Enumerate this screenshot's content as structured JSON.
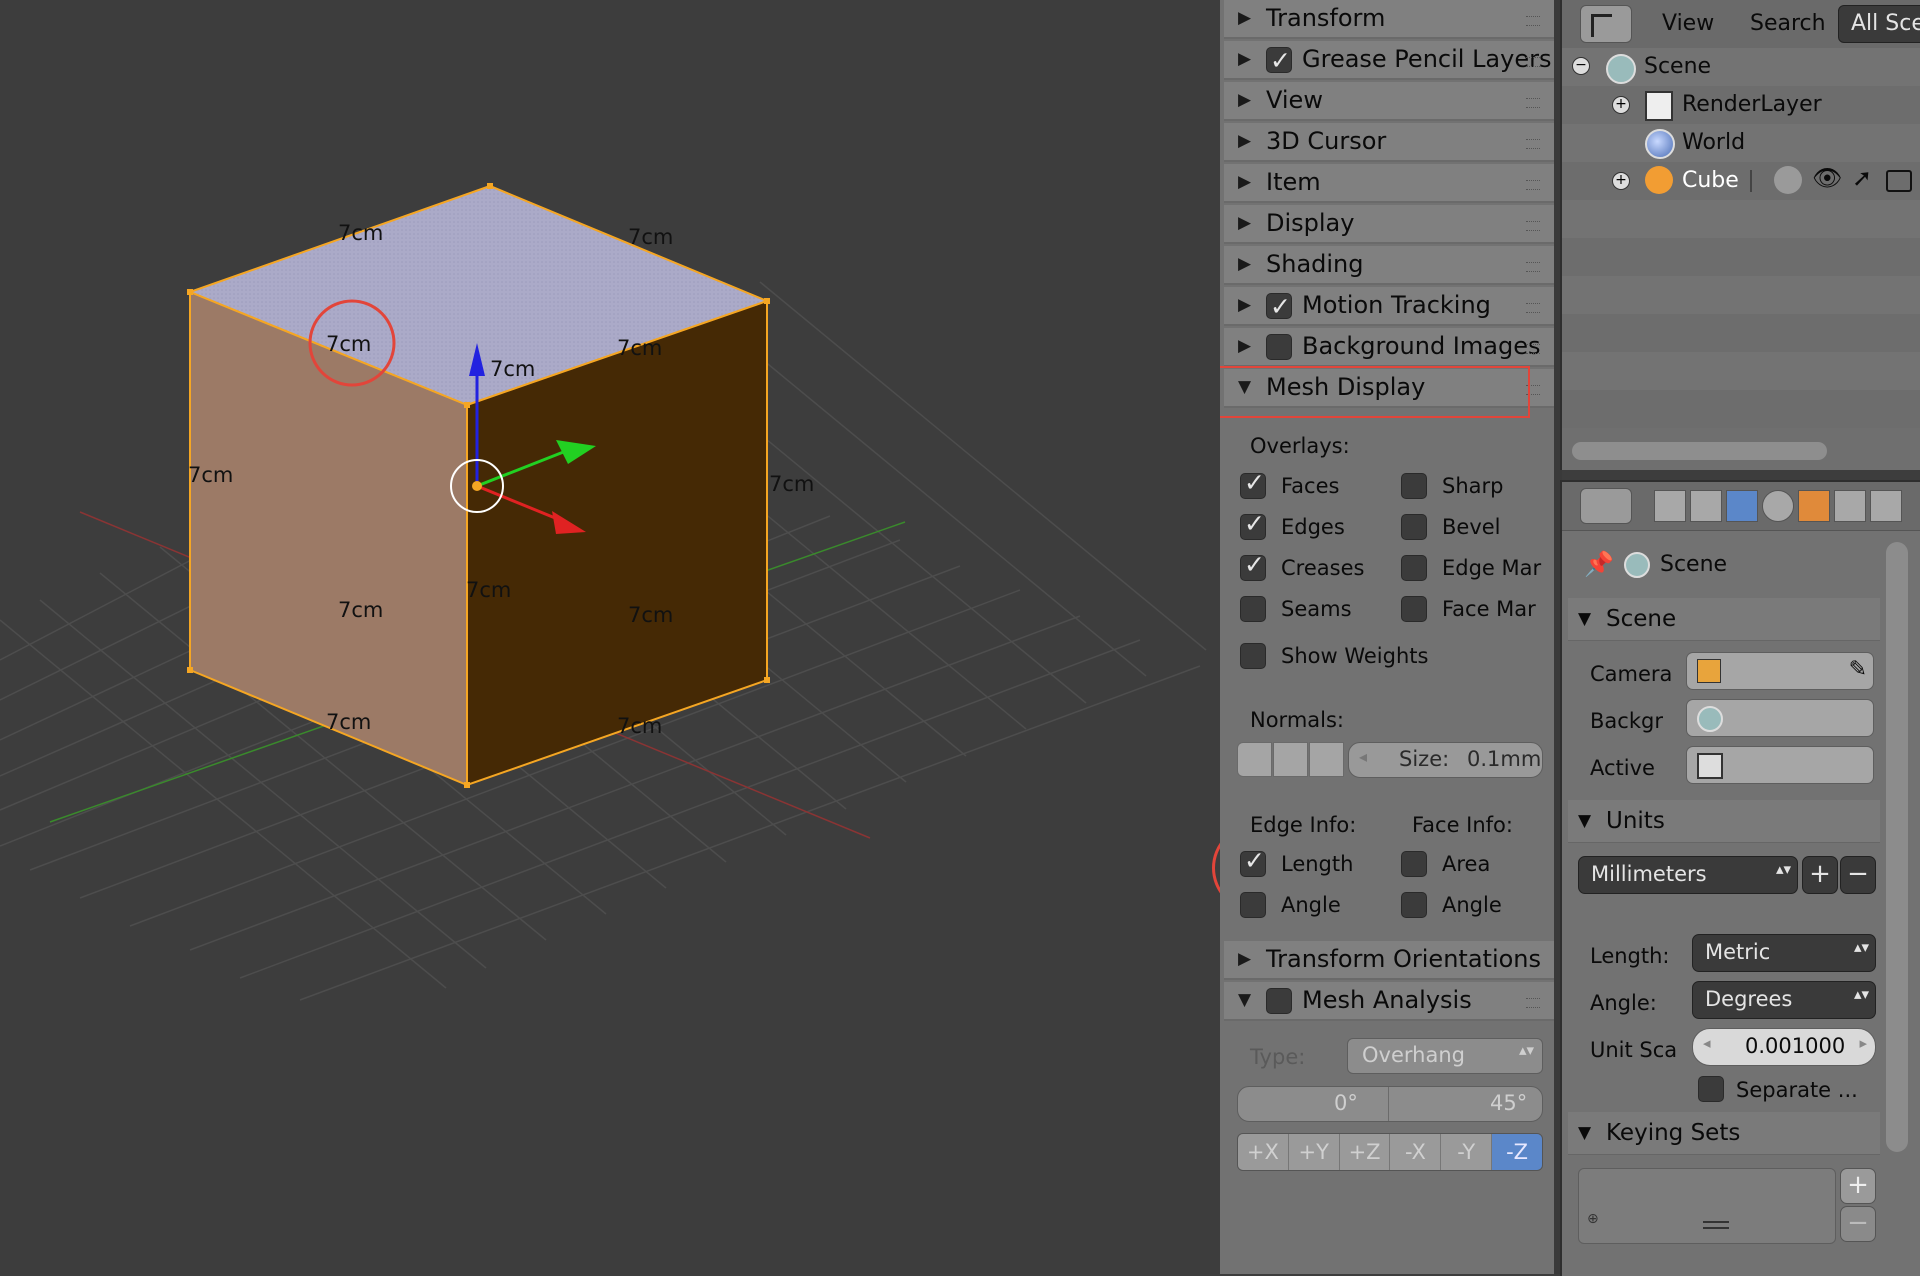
{
  "viewport": {
    "dimension_labels": [
      "7cm",
      "7cm",
      "7cm",
      "7cm",
      "7cm",
      "7cm",
      "7cm",
      "7cm",
      "7cm",
      "7cm",
      "7cm",
      "7cm"
    ],
    "colors": {
      "background": "#3d3d3d",
      "top_face": "#a9a9c7",
      "left_face": "#9c7a66",
      "right_face": "#452905",
      "selection": "#f5a623",
      "annotation": "#e2453a"
    }
  },
  "npanel": {
    "sections": [
      {
        "label": "Transform",
        "expanded": false
      },
      {
        "label": "Grease Pencil Layers",
        "expanded": false,
        "checkbox": true
      },
      {
        "label": "View",
        "expanded": false
      },
      {
        "label": "3D Cursor",
        "expanded": false
      },
      {
        "label": "Item",
        "expanded": false
      },
      {
        "label": "Display",
        "expanded": false
      },
      {
        "label": "Shading",
        "expanded": false
      },
      {
        "label": "Motion Tracking",
        "expanded": false,
        "checkbox": true
      },
      {
        "label": "Background Images",
        "expanded": false,
        "checkbox": false
      },
      {
        "label": "Mesh Display",
        "expanded": true
      }
    ],
    "mesh_display": {
      "overlays_label": "Overlays:",
      "overlays": [
        {
          "label": "Faces",
          "checked": true
        },
        {
          "label": "Sharp",
          "checked": false
        },
        {
          "label": "Edges",
          "checked": true
        },
        {
          "label": "Bevel",
          "checked": false
        },
        {
          "label": "Creases",
          "checked": true
        },
        {
          "label": "Edge Mar",
          "checked": false
        },
        {
          "label": "Seams",
          "checked": false
        },
        {
          "label": "Face Mar",
          "checked": false
        }
      ],
      "show_weights": {
        "label": "Show Weights",
        "checked": false
      },
      "normals_label": "Normals:",
      "normals_size_label": "Size:",
      "normals_size_value": "0.1mm",
      "edge_info_label": "Edge Info:",
      "face_info_label": "Face Info:",
      "edge_length": {
        "label": "Length",
        "checked": true
      },
      "edge_angle": {
        "label": "Angle",
        "checked": false
      },
      "face_area": {
        "label": "Area",
        "checked": false
      },
      "face_angle": {
        "label": "Angle",
        "checked": false
      }
    },
    "transform_orientations": "Transform Orientations",
    "mesh_analysis": {
      "label": "Mesh Analysis",
      "type_label": "Type:",
      "type_value": "Overhang",
      "min_angle": "0°",
      "max_angle": "45°",
      "axes": [
        "+X",
        "+Y",
        "+Z",
        "-X",
        "-Y",
        "-Z"
      ]
    }
  },
  "outliner": {
    "menu": [
      "View",
      "Search"
    ],
    "filter": "All Sce",
    "tree": [
      {
        "label": "Scene",
        "icon": "scene-icon"
      },
      {
        "label": "RenderLayer",
        "icon": "renderlayer-icon"
      },
      {
        "label": "World",
        "icon": "world-icon"
      },
      {
        "label": "Cube",
        "icon": "mesh-object-icon"
      }
    ]
  },
  "properties": {
    "context_label": "Scene",
    "scene_section": {
      "title": "Scene",
      "camera_label": "Camera",
      "background_label": "Backgr",
      "active_label": "Active"
    },
    "units_section": {
      "title": "Units",
      "preset": "Millimeters",
      "length_label": "Length:",
      "length_value": "Metric",
      "angle_label": "Angle:",
      "angle_value": "Degrees",
      "scale_label": "Unit Sca",
      "scale_value": "0.001000",
      "separate_label": "Separate ..."
    },
    "keying_section": {
      "title": "Keying Sets"
    }
  }
}
